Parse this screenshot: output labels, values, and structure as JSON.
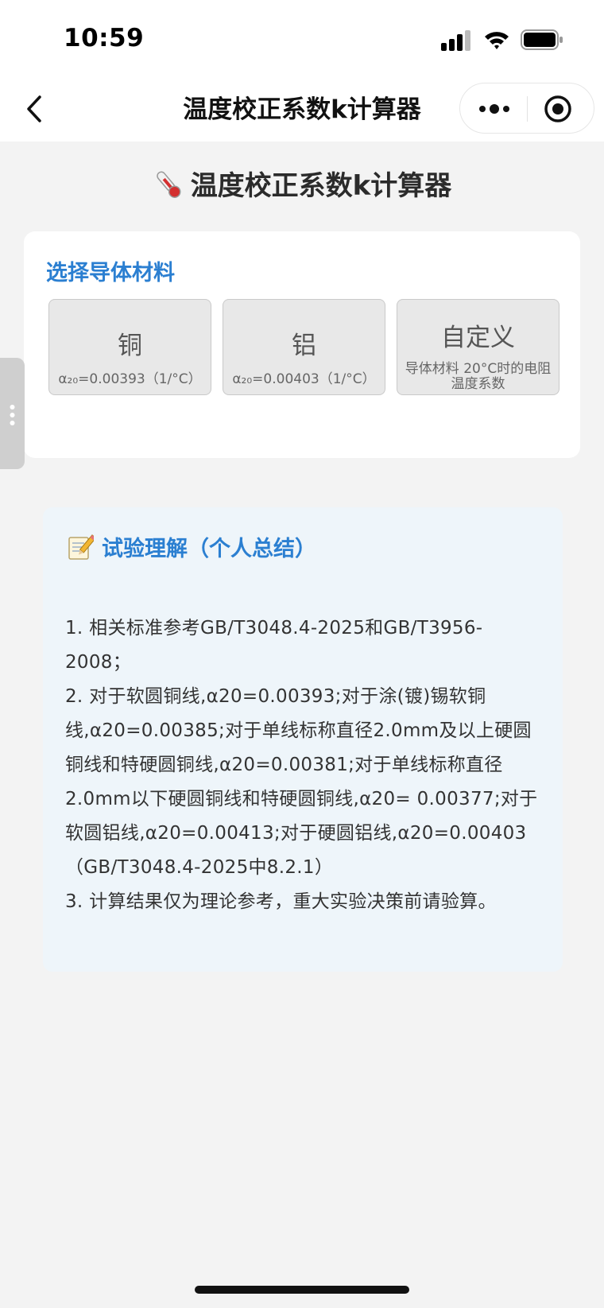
{
  "status_bar": {
    "time": "10:59",
    "signal_icon": "cellular-signal-icon",
    "wifi_icon": "wifi-icon",
    "battery_icon": "battery-icon"
  },
  "nav": {
    "back_icon": "chevron-left-icon",
    "title": "温度校正系数k计算器",
    "more_icon": "more-dots-icon",
    "close_icon": "target-close-icon"
  },
  "page": {
    "title_icon": "thermometer-icon",
    "title": "温度校正系数k计算器"
  },
  "material": {
    "heading": "选择导体材料",
    "options": [
      {
        "name": "铜",
        "desc": "α₂₀=0.00393（1/°C）"
      },
      {
        "name": "铝",
        "desc": "α₂₀=0.00403（1/°C）"
      },
      {
        "name": "自定义",
        "desc": "导体材料 20°C时的电阻温度系数"
      }
    ]
  },
  "notes": {
    "heading_icon": "memo-icon",
    "heading": "试验理解（个人总结）",
    "items": [
      "1. 相关标准参考GB/T3048.4-2025和GB/T3956-2008；",
      "2. 对于软圆铜线,α20=0.00393;对于涂(镀)锡软铜线,α20=0.00385;对于单线标称直径2.0mm及以上硬圆铜线和特硬圆铜线,α20=0.00381;对于单线标称直径2.0mm以下硬圆铜线和特硬圆铜线,α20= 0.00377;对于软圆铝线,α20=0.00413;对于硬圆铝线,α20=0.00403（GB/T3048.4-2025中8.2.1）",
      "3. 计算结果仅为理论参考，重大实验决策前请验算。"
    ]
  },
  "colors": {
    "accent": "#2b7fd1",
    "page_bg": "#f3f3f3",
    "notes_bg": "#eef5fa"
  }
}
